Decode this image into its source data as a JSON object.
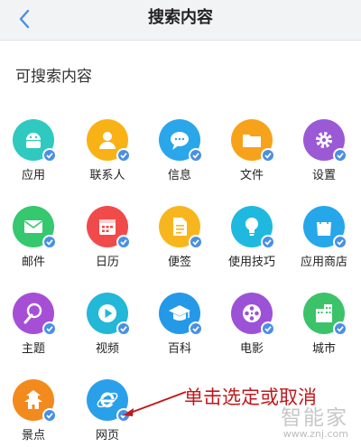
{
  "header": {
    "title": "搜索内容"
  },
  "section": {
    "title": "可搜索内容"
  },
  "items": [
    {
      "label": "应用",
      "color": "#2fc9c0",
      "icon": "android-icon"
    },
    {
      "label": "联系人",
      "color": "#f9b216",
      "icon": "contact-icon"
    },
    {
      "label": "信息",
      "color": "#2aa6ea",
      "icon": "message-icon"
    },
    {
      "label": "文件",
      "color": "#f7a21b",
      "icon": "folder-icon"
    },
    {
      "label": "设置",
      "color": "#9b59d6",
      "icon": "gear-icon"
    },
    {
      "label": "邮件",
      "color": "#35c86f",
      "icon": "mail-icon"
    },
    {
      "label": "日历",
      "color": "#f14a4a",
      "icon": "calendar-icon"
    },
    {
      "label": "便签",
      "color": "#f8b61e",
      "icon": "note-icon"
    },
    {
      "label": "使用技巧",
      "color": "#1fb9e0",
      "icon": "bulb-icon"
    },
    {
      "label": "应用商店",
      "color": "#25a7ea",
      "icon": "bag-icon"
    },
    {
      "label": "主题",
      "color": "#a64fd6",
      "icon": "palette-icon"
    },
    {
      "label": "视频",
      "color": "#23b7d8",
      "icon": "play-icon"
    },
    {
      "label": "百科",
      "color": "#2499e8",
      "icon": "graduation-cap-icon"
    },
    {
      "label": "电影",
      "color": "#9c52d6",
      "icon": "film-reel-icon"
    },
    {
      "label": "城市",
      "color": "#3cc36a",
      "icon": "building-icon"
    },
    {
      "label": "景点",
      "color": "#f38a1e",
      "icon": "pagoda-icon"
    },
    {
      "label": "网页",
      "color": "#2aa0ea",
      "icon": "browser-e-icon"
    }
  ],
  "annotation": {
    "text": "单击选定或取消"
  },
  "watermark": {
    "brand": "智能家",
    "url": "www.znj.com"
  }
}
